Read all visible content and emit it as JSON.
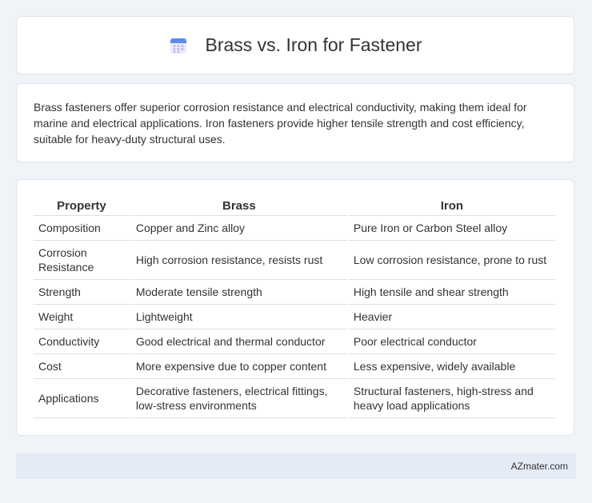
{
  "header": {
    "title": "Brass vs. Iron for Fastener",
    "icon": "calendar-icon"
  },
  "summary": {
    "text": "Brass fasteners offer superior corrosion resistance and electrical conductivity, making them ideal for marine and electrical applications. Iron fasteners provide higher tensile strength and cost efficiency, suitable for heavy-duty structural uses."
  },
  "table": {
    "headers": [
      "Property",
      "Brass",
      "Iron"
    ],
    "rows": [
      [
        "Composition",
        "Copper and Zinc alloy",
        "Pure Iron or Carbon Steel alloy"
      ],
      [
        "Corrosion Resistance",
        "High corrosion resistance, resists rust",
        "Low corrosion resistance, prone to rust"
      ],
      [
        "Strength",
        "Moderate tensile strength",
        "High tensile and shear strength"
      ],
      [
        "Weight",
        "Lightweight",
        "Heavier"
      ],
      [
        "Conductivity",
        "Good electrical and thermal conductor",
        "Poor electrical conductor"
      ],
      [
        "Cost",
        "More expensive due to copper content",
        "Less expensive, widely available"
      ],
      [
        "Applications",
        "Decorative fasteners, electrical fittings, low-stress environments",
        "Structural fasteners, high-stress and heavy load applications"
      ]
    ]
  },
  "footer": {
    "source": "AZmater.com"
  }
}
